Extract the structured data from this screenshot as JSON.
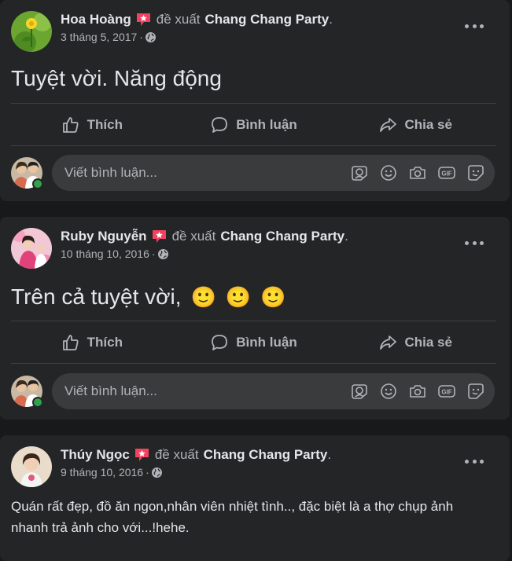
{
  "common": {
    "recommends": "đề xuất",
    "page_name": "Chang Chang Party",
    "period": ".",
    "separator": "·",
    "like": "Thích",
    "comment": "Bình luận",
    "share": "Chia sẻ",
    "comment_placeholder": "Viết bình luận..."
  },
  "posts": [
    {
      "author": "Hoa Hoàng",
      "date": "3 tháng 5, 2017",
      "text": "Tuyệt vời. Năng động"
    },
    {
      "author": "Ruby Nguyễn",
      "date": "10 tháng 10, 2016",
      "text": "Trên cả tuyệt vời,",
      "emojis": [
        "🙂",
        "🙂",
        "🙂"
      ]
    },
    {
      "author": "Thúy Ngọc",
      "date": "9 tháng 10, 2016",
      "text": "Quán rất đẹp, đồ ăn ngon,nhân viên nhiệt tình.., đặc biệt là a thợ chụp ảnh nhanh trả ảnh cho với...!hehe."
    }
  ],
  "colors": {
    "background": "#18191a",
    "card": "#242526",
    "recommend_icon": "#f3425f",
    "online": "#31a24c",
    "emoji": "#f7c42a"
  }
}
